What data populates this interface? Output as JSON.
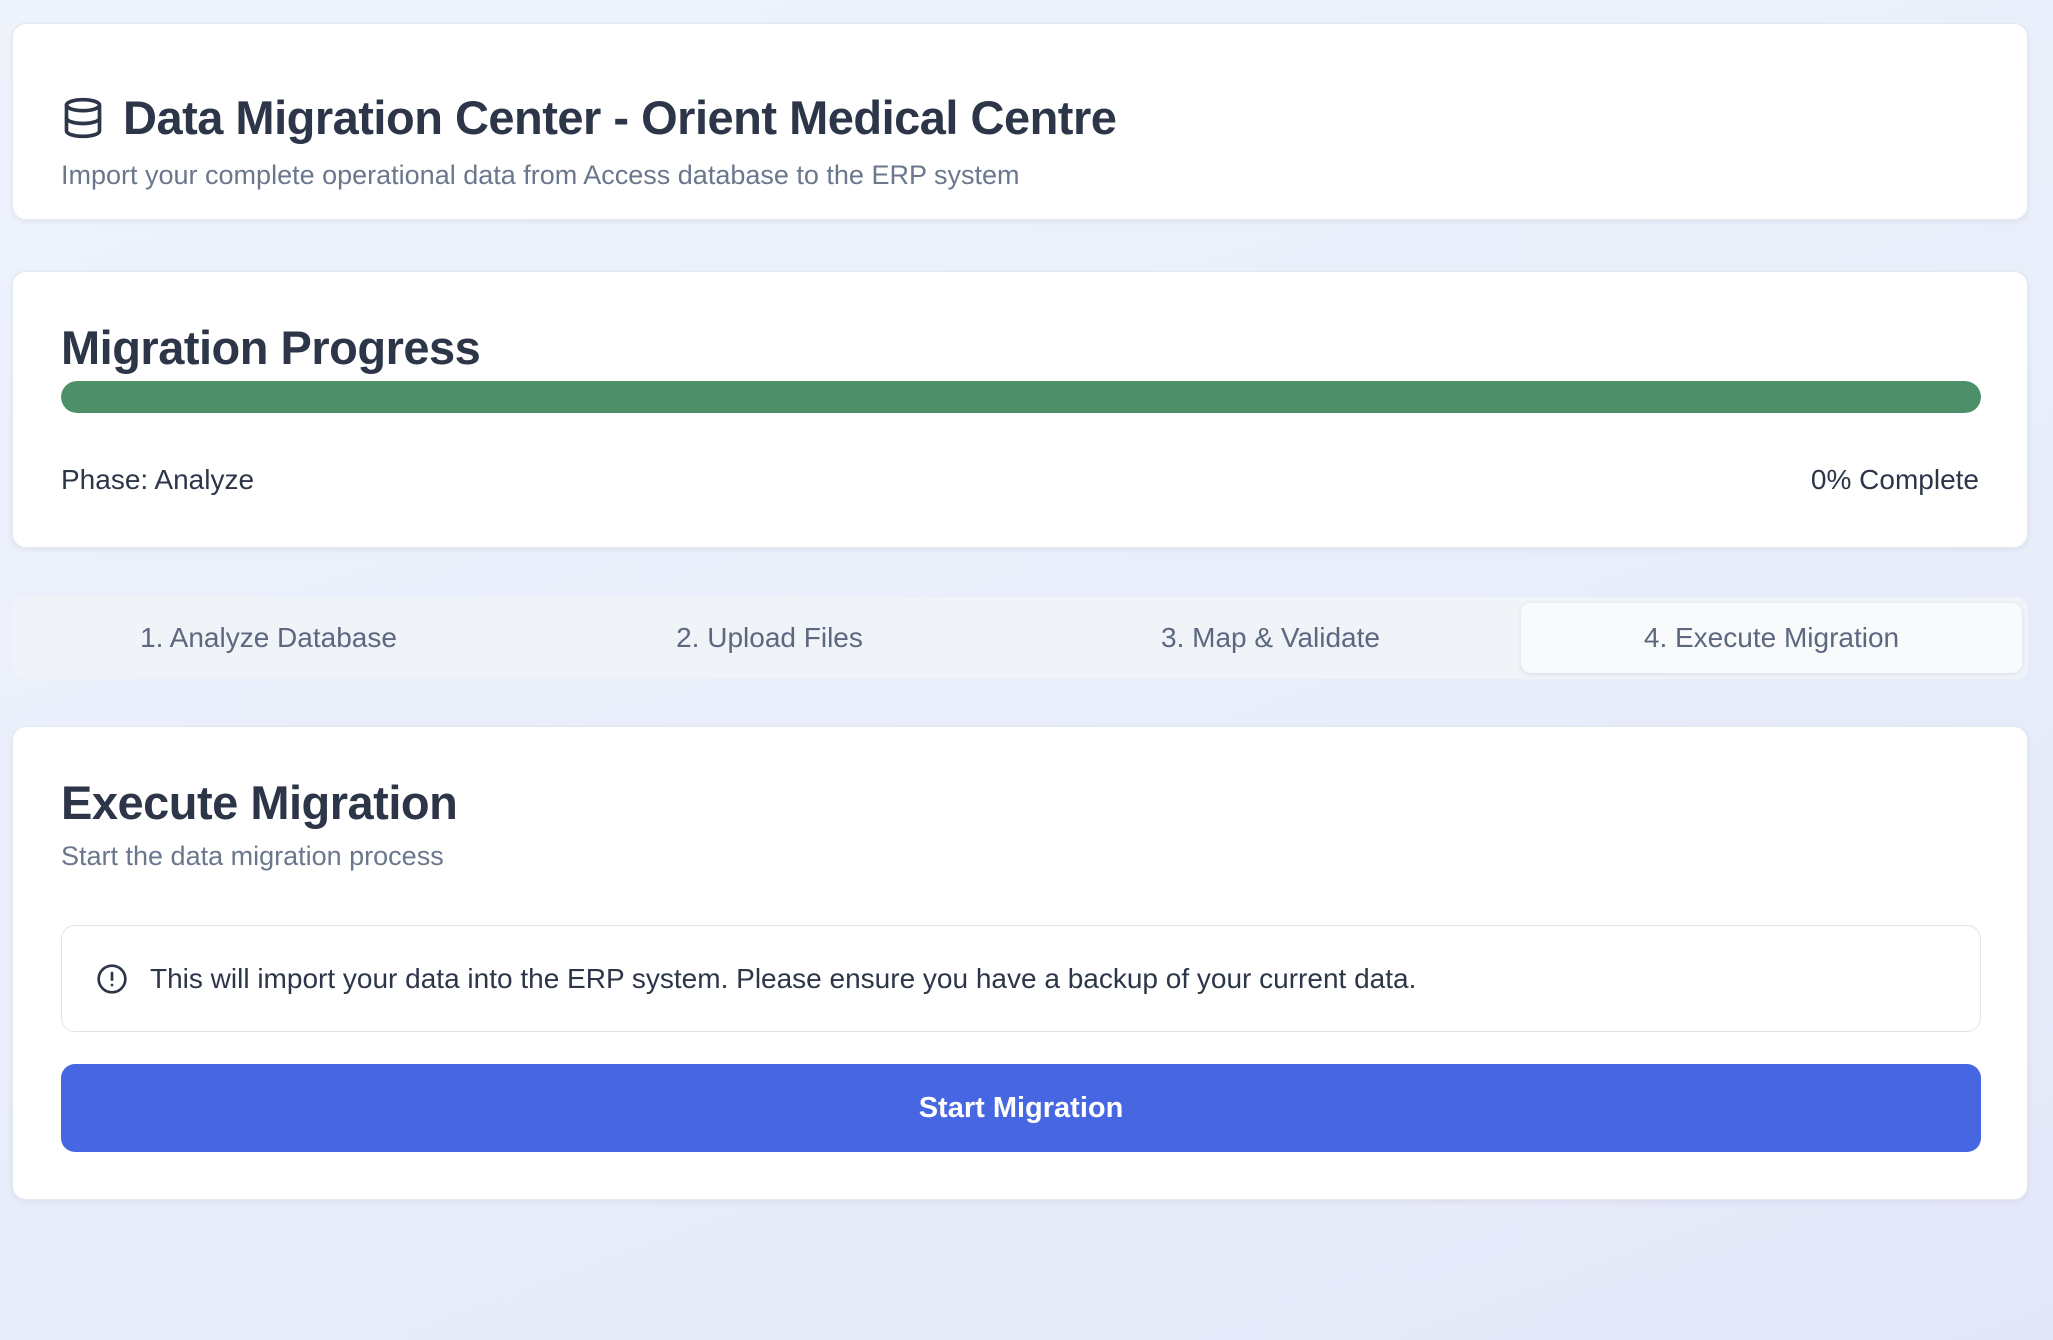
{
  "header": {
    "icon": "database-icon",
    "title": "Data Migration Center - Orient Medical Centre",
    "subtitle": "Import your complete operational data from Access database to the ERP system"
  },
  "progress": {
    "title": "Migration Progress",
    "fill_fraction": 1.0,
    "fill_color": "#4c8f69",
    "phase_label": "Phase: Analyze",
    "percent_label": "0% Complete"
  },
  "tabs": [
    {
      "label": "1. Analyze Database",
      "active": false
    },
    {
      "label": "2. Upload Files",
      "active": false
    },
    {
      "label": "3. Map & Validate",
      "active": false
    },
    {
      "label": "4. Execute Migration",
      "active": true
    }
  ],
  "execute": {
    "title": "Execute Migration",
    "subtitle": "Start the data migration process",
    "alert": {
      "icon": "alert-circle-icon",
      "text": "This will import your data into the ERP system. Please ensure you have a backup of your current data."
    },
    "button_label": "Start Migration",
    "button_color": "#4667e1"
  }
}
